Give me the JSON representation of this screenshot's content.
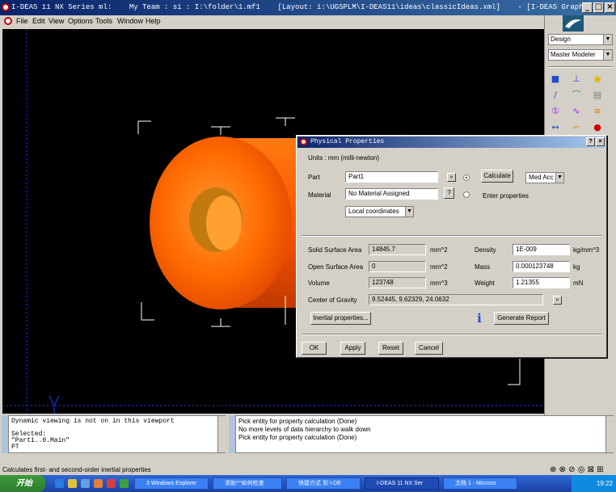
{
  "window": {
    "title": "I-DEAS 11 NX Series ml:    My Team : si : I:\\folder\\1.mf1    [Layout: i:\\UGSPLM\\I-DEAS11\\ideas\\classicIdeas.xml]    - [I-DEAS Graphics]"
  },
  "menu": [
    "File",
    "Edit",
    "View",
    "Options",
    "Tools",
    "Window",
    "Help"
  ],
  "right_panel": {
    "task_select": "Design",
    "app_select": "Master Modeler"
  },
  "dialog": {
    "title": "Physical Properties",
    "units": "Units : mm (milli-newton)",
    "part_label": "Part",
    "part_value": "Part1",
    "material_label": "Material",
    "material_value": "No Material Assigned",
    "question_btn": "?",
    "calculate_btn": "Calculate",
    "accuracy": "Med Acc",
    "enter_properties": "Enter properties",
    "coords": "Local coordinates",
    "solid_area_label": "Solid Surface Area",
    "solid_area_value": "14845.7",
    "solid_area_unit": "mm^2",
    "open_area_label": "Open Surface Area",
    "open_area_value": "0",
    "open_area_unit": "mm^2",
    "volume_label": "Volume",
    "volume_value": "123748",
    "volume_unit": "mm^3",
    "density_label": "Density",
    "density_value": "1E-009",
    "density_unit": "kg/mm^3",
    "mass_label": "Mass",
    "mass_value": "0.000123748",
    "mass_unit": "kg",
    "weight_label": "Weight",
    "weight_value": "1.21355",
    "weight_unit": "mN",
    "cog_label": "Center of Gravity",
    "cog_value": "9.52445, 9.62329, 24.0632",
    "inertial_btn": "Inertial properties...",
    "info_icon_char": "i",
    "report_btn": "Generate Report",
    "ok_btn": "OK",
    "apply_btn": "Apply",
    "reset_btn": "Reset",
    "cancel_btn": "Cancel"
  },
  "log_left": "Dynamic viewing is not on in this viewport\n\nSelected:\n\"Part1..0.Main\"\nPT",
  "log_right": [
    "Pick entity for property calculation (Done)",
    "No more levels of data hierarchy to walk down",
    "Pick entity for property calculation (Done)"
  ],
  "status": "Calculates first- and second-order inertial properties",
  "taskbar": {
    "start": "开始",
    "tasks": [
      "3 Windows Explorer",
      "求助^^如何检查",
      "快捷方式 到 I-DE",
      "I-DEAS 11 NX Ser",
      "文档 1 - Microso"
    ],
    "clock": "19:22"
  },
  "colors": {
    "ring_outer": "#ff5a00",
    "ring_inner": "#ff9a30",
    "viewport_bg": "#000000",
    "title_bar": "#0a246a"
  }
}
